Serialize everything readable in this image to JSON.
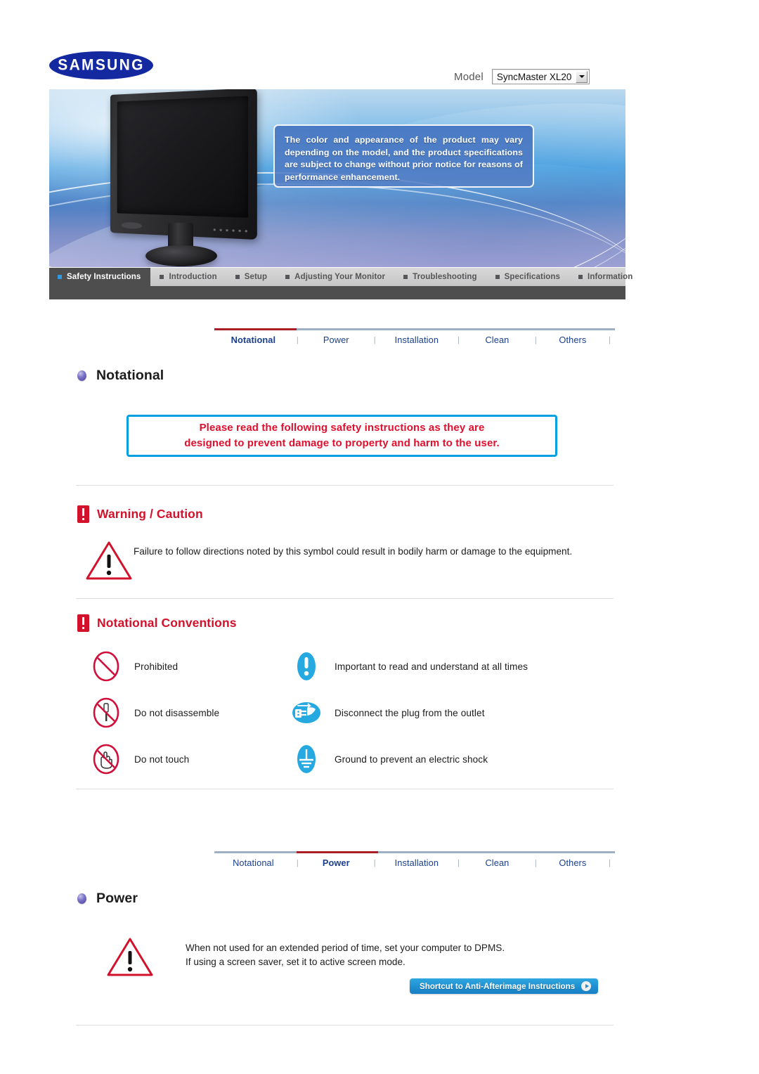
{
  "brand": {
    "logo_text": "SAMSUNG"
  },
  "model": {
    "label": "Model",
    "selected": "SyncMaster XL20",
    "options": [
      "SyncMaster XL20"
    ]
  },
  "banner": {
    "note": "The color and appearance of the product may vary depending on the model, and the product specifications are subject to change without prior notice for reasons of performance enhancement."
  },
  "mainnav": {
    "tabs": [
      {
        "label": "Safety Instructions",
        "active": true
      },
      {
        "label": "Introduction",
        "active": false
      },
      {
        "label": "Setup",
        "active": false
      },
      {
        "label": "Adjusting Your Monitor",
        "active": false
      },
      {
        "label": "Troubleshooting",
        "active": false
      },
      {
        "label": "Specifications",
        "active": false
      },
      {
        "label": "Information",
        "active": false
      }
    ]
  },
  "subnav_top": {
    "items": [
      {
        "label": "Notational",
        "active": true
      },
      {
        "label": "Power",
        "active": false
      },
      {
        "label": "Installation",
        "active": false
      },
      {
        "label": "Clean",
        "active": false
      },
      {
        "label": "Others",
        "active": false
      }
    ]
  },
  "subnav_bottom": {
    "items": [
      {
        "label": "Notational",
        "active": false
      },
      {
        "label": "Power",
        "active": true
      },
      {
        "label": "Installation",
        "active": false
      },
      {
        "label": "Clean",
        "active": false
      },
      {
        "label": "Others",
        "active": false
      }
    ]
  },
  "sections": {
    "notational_title": "Notational",
    "power_title": "Power"
  },
  "info_box": {
    "line1": "Please read the following safety instructions as they are",
    "line2": "designed to prevent damage to property and harm to the user."
  },
  "warning": {
    "heading": "Warning / Caution",
    "body": "Failure to follow directions noted by this symbol could result in bodily harm or damage to the equipment."
  },
  "conventions": {
    "heading": "Notational Conventions",
    "rows": [
      {
        "left_icon": "prohibited-icon",
        "left_label": "Prohibited",
        "right_icon": "important-icon",
        "right_label": "Important to read and understand at all times"
      },
      {
        "left_icon": "do-not-disassemble-icon",
        "left_label": "Do not disassemble",
        "right_icon": "disconnect-plug-icon",
        "right_label": "Disconnect the plug from the outlet"
      },
      {
        "left_icon": "do-not-touch-icon",
        "left_label": "Do not touch",
        "right_icon": "ground-icon",
        "right_label": "Ground to prevent an electric shock"
      }
    ]
  },
  "power": {
    "line1": "When not used for an extended period of time, set your computer to DPMS.",
    "line2": "If using a screen saver, set it to active screen mode.",
    "shortcut_label": "Shortcut to Anti-Afterimage Instructions"
  },
  "colors": {
    "samsung_blue": "#1428a0",
    "accent_red": "#d2112b",
    "info_red": "#e10f2e",
    "info_border_blue": "#00a0e0",
    "link_blue": "#1a3f8f",
    "nav_active_bg": "#4e4e4e",
    "sub_rule": "#9eb0c4",
    "sub_rule_active": "#aa1e28"
  }
}
